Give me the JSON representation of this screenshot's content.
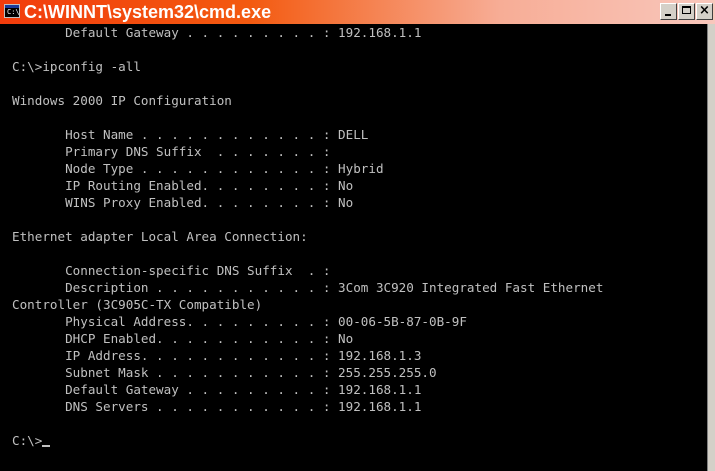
{
  "window": {
    "title": "C:\\WINNT\\system32\\cmd.exe",
    "icon": "console-icon",
    "icon_glyph": "C:\\",
    "controls": {
      "minimize_icon": "minimize-icon",
      "maximize_icon": "maximize-icon",
      "close_icon": "close-icon",
      "close_glyph": "×"
    },
    "colors": {
      "titlebar_start": "#f23c0c",
      "titlebar_end": "#f9c7bc",
      "console_bg": "#000000",
      "console_text": "#c0c0c0"
    }
  },
  "console": {
    "lines": [
      "       Default Gateway . . . . . . . . . : 192.168.1.1",
      "",
      "C:\\>ipconfig -all",
      "",
      "Windows 2000 IP Configuration",
      "",
      "       Host Name . . . . . . . . . . . . : DELL",
      "       Primary DNS Suffix  . . . . . . . :",
      "       Node Type . . . . . . . . . . . . : Hybrid",
      "       IP Routing Enabled. . . . . . . . : No",
      "       WINS Proxy Enabled. . . . . . . . : No",
      "",
      "Ethernet adapter Local Area Connection:",
      "",
      "       Connection-specific DNS Suffix  . :",
      "       Description . . . . . . . . . . . : 3Com 3C920 Integrated Fast Ethernet",
      "Controller (3C905C-TX Compatible)",
      "       Physical Address. . . . . . . . . : 00-06-5B-87-0B-9F",
      "       DHCP Enabled. . . . . . . . . . . : No",
      "       IP Address. . . . . . . . . . . . : 192.168.1.3",
      "       Subnet Mask . . . . . . . . . . . : 255.255.255.0",
      "       Default Gateway . . . . . . . . . : 192.168.1.1",
      "       DNS Servers . . . . . . . . . . . : 192.168.1.1",
      "",
      "C:\\>"
    ]
  }
}
